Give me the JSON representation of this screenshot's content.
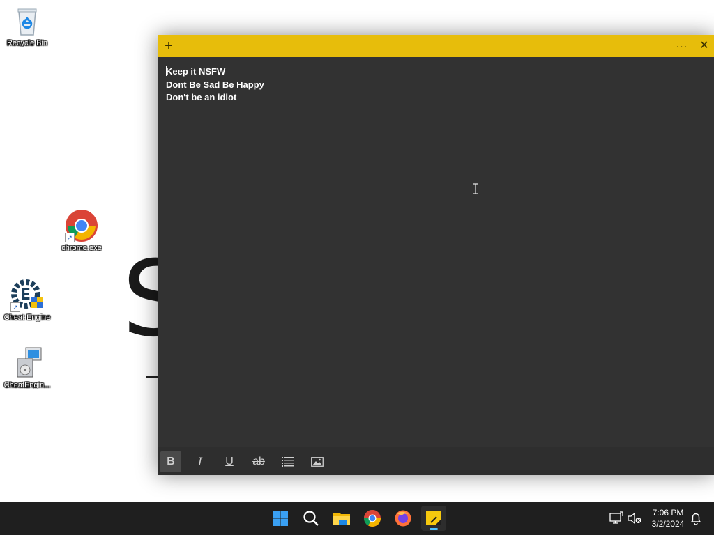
{
  "desktop": {
    "wallpaper_text": "S",
    "icons": [
      {
        "label": "Recycle Bin",
        "icon": "recycle-bin-icon"
      },
      {
        "label": "chrome.exe",
        "icon": "chrome-icon"
      },
      {
        "label": "Cheat Engine",
        "icon": "cheat-engine-icon"
      },
      {
        "label": "CheatEngin...",
        "icon": "installer-icon"
      }
    ]
  },
  "sticky_note": {
    "titlebar_color": "#e7bd0b",
    "new_note_label": "+",
    "menu_label": "···",
    "close_label": "✕",
    "lines": [
      "Keep it NSFW",
      "Dont Be Sad Be Happy",
      "Don't be an idiot"
    ],
    "toolbar": {
      "bold": "B",
      "italic": "I",
      "underline": "U",
      "strikethrough": "ab",
      "bold_active": true
    }
  },
  "taskbar": {
    "apps": [
      "start-icon",
      "search-icon",
      "file-explorer-icon",
      "chrome-icon",
      "firefox-icon",
      "sticky-notes-icon"
    ],
    "clock": {
      "time": "7:06 PM",
      "date": "3/2/2024"
    }
  }
}
